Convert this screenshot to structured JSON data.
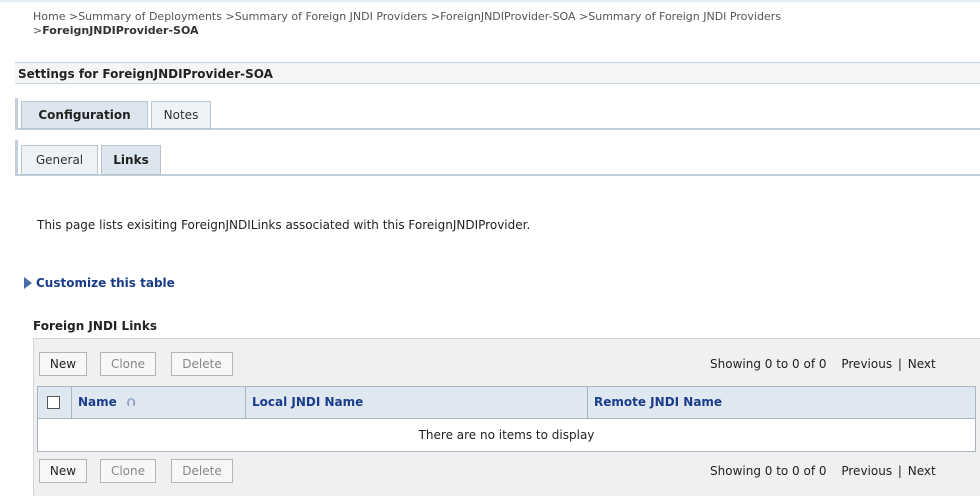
{
  "breadcrumb": {
    "items": [
      "Home",
      "Summary of Deployments",
      "Summary of Foreign JNDI Providers",
      "ForeignJNDIProvider-SOA",
      "Summary of Foreign JNDI Providers"
    ],
    "current": "ForeignJNDIProvider-SOA"
  },
  "settings_title": "Settings for ForeignJNDIProvider-SOA",
  "tabs": [
    {
      "label": "Configuration"
    },
    {
      "label": "Notes"
    }
  ],
  "subtabs": [
    {
      "label": "General"
    },
    {
      "label": "Links"
    }
  ],
  "intro_text": "This page lists exisiting ForeignJNDILinks associated with this ForeignJNDIProvider.",
  "customize_label": "Customize this table",
  "table": {
    "title": "Foreign JNDI Links",
    "buttons": {
      "new": "New",
      "clone": "Clone",
      "delete": "Delete"
    },
    "pager": {
      "showing": "Showing 0 to 0 of 0",
      "previous": "Previous",
      "separator": "|",
      "next": "Next"
    },
    "columns": [
      "Name",
      "Local JNDI Name",
      "Remote JNDI Name"
    ],
    "empty_message": "There are no items to display"
  }
}
